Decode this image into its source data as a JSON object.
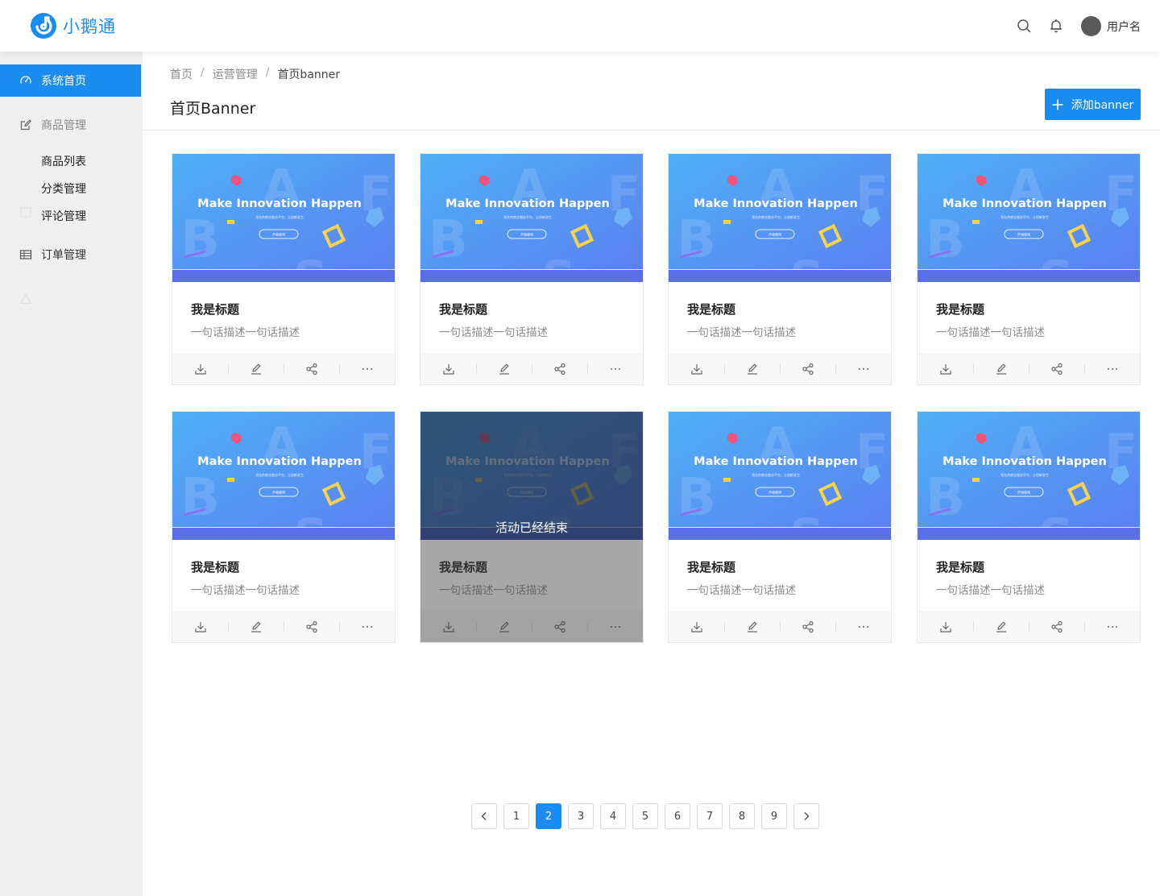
{
  "header": {
    "app_name": "小鹅通",
    "username": "用户名"
  },
  "sidebar": {
    "home": "系统首页",
    "goods": "商品管理",
    "goods_list": "商品列表",
    "category": "分类管理",
    "comments": "评论管理",
    "orders": "订单管理"
  },
  "breadcrumb": [
    "首页",
    "/",
    "运营管理",
    "/",
    "首页banner"
  ],
  "page_title": "首页Banner",
  "add_button": "添加banner",
  "banner_text": {
    "headline": "Make Innovation Happen",
    "sub": "领先的商业服务平台，让创新发生",
    "button": "开始使用"
  },
  "cards": [
    {
      "title": "我是标题",
      "desc": "一句话描述一句话描述",
      "ended": false
    },
    {
      "title": "我是标题",
      "desc": "一句话描述一句话描述",
      "ended": false
    },
    {
      "title": "我是标题",
      "desc": "一句话描述一句话描述",
      "ended": false
    },
    {
      "title": "我是标题",
      "desc": "一句话描述一句话描述",
      "ended": false
    },
    {
      "title": "我是标题",
      "desc": "一句话描述一句话描述",
      "ended": false
    },
    {
      "title": "我是标题",
      "desc": "一句话描述一句话描述",
      "ended": true,
      "overlay": "活动已经结束"
    },
    {
      "title": "我是标题",
      "desc": "一句话描述一句话描述",
      "ended": false
    },
    {
      "title": "我是标题",
      "desc": "一句话描述一句话描述",
      "ended": false
    }
  ],
  "card_actions": [
    "download-icon",
    "edit-icon",
    "share-icon",
    "more-icon"
  ],
  "pagination": {
    "pages": [
      "1",
      "2",
      "3",
      "4",
      "5",
      "6",
      "7",
      "8",
      "9"
    ],
    "current": "2"
  },
  "colors": {
    "primary": "#1a8cf0",
    "sidebar_bg": "#efefef"
  }
}
